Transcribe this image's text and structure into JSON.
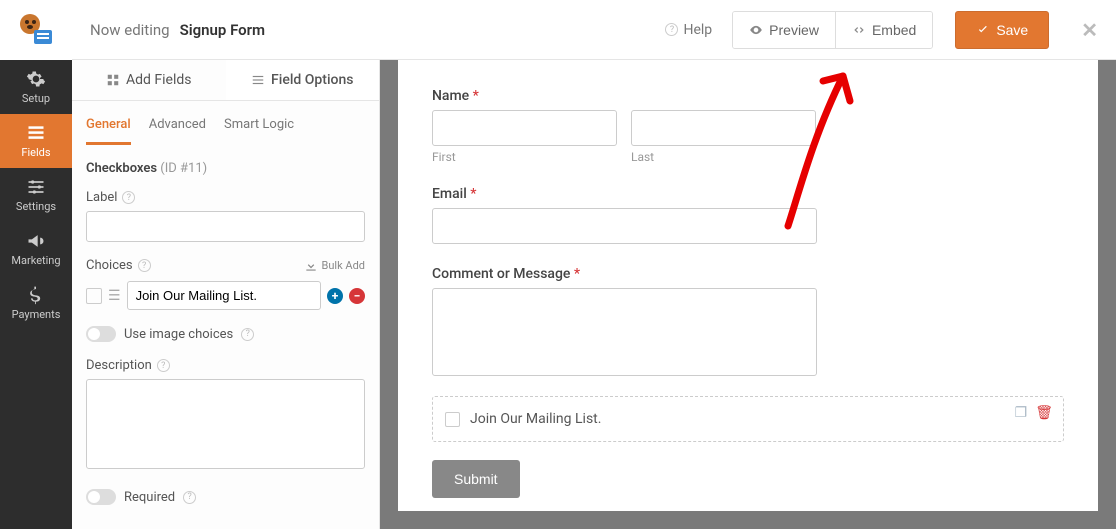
{
  "topbar": {
    "prefix": "Now editing",
    "form_name": "Signup Form",
    "help": "Help",
    "preview": "Preview",
    "embed": "Embed",
    "save": "Save"
  },
  "nav": {
    "setup": "Setup",
    "fields": "Fields",
    "settings": "Settings",
    "marketing": "Marketing",
    "payments": "Payments"
  },
  "side_tabs": {
    "add_fields": "Add Fields",
    "field_options": "Field Options"
  },
  "sub_tabs": {
    "general": "General",
    "advanced": "Advanced",
    "smart_logic": "Smart Logic"
  },
  "panel": {
    "field_type": "Checkboxes",
    "field_id": "(ID #11)",
    "label_label": "Label",
    "label_value": "",
    "choices_label": "Choices",
    "bulk_add": "Bulk Add",
    "choice_value": "Join Our Mailing List.",
    "image_choices": "Use image choices",
    "description_label": "Description",
    "description_value": "",
    "required_label": "Required"
  },
  "preview": {
    "name_label": "Name",
    "first": "First",
    "last": "Last",
    "email_label": "Email",
    "comment_label": "Comment or Message",
    "checkbox_choice": "Join Our Mailing List.",
    "submit": "Submit"
  }
}
